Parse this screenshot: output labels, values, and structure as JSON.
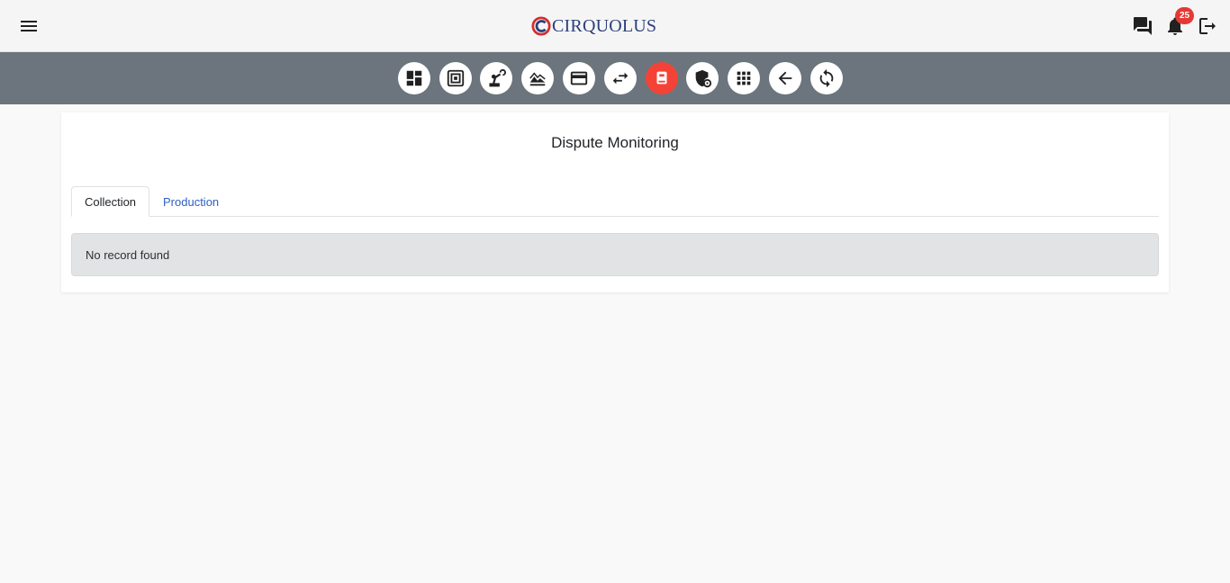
{
  "header": {
    "brand": "CIRQUOLUS",
    "notification_count": "25",
    "icons": [
      "menu-icon",
      "chat-icon",
      "bell-icon",
      "logout-icon"
    ]
  },
  "toolbar": {
    "buttons": [
      {
        "icon": "dashboard-icon"
      },
      {
        "icon": "reports-icon"
      },
      {
        "icon": "robot-arm-icon"
      },
      {
        "icon": "landscape-icon"
      },
      {
        "icon": "credit-card-icon"
      },
      {
        "icon": "swap-icon"
      },
      {
        "icon": "dispute-icon",
        "active": true
      },
      {
        "icon": "shield-settings-icon"
      },
      {
        "icon": "apps-grid-icon"
      },
      {
        "icon": "back-arrow-icon"
      },
      {
        "icon": "refresh-icon"
      }
    ],
    "active_color": "#f44336",
    "bar_color": "#6c757d"
  },
  "main": {
    "title": "Dispute Monitoring",
    "tabs": [
      {
        "label": "Collection",
        "active": true
      },
      {
        "label": "Production",
        "active": false
      }
    ],
    "empty_message": "No record found"
  },
  "colors": {
    "brand_blue": "#2b3f7a",
    "brand_red": "#d32f2f",
    "link": "#2f5fc4",
    "badge": "#e53935"
  }
}
